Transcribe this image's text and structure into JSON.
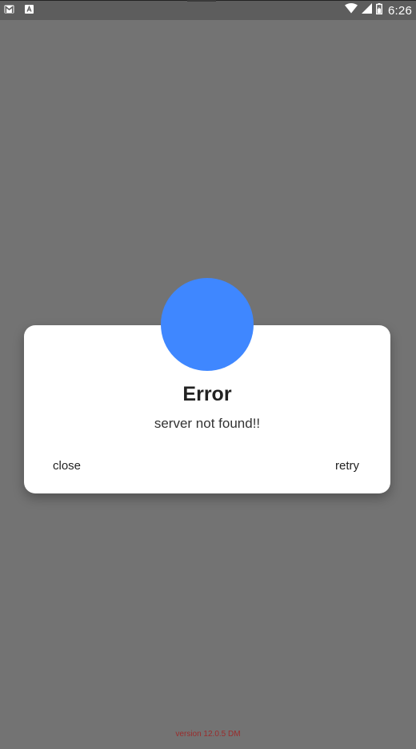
{
  "status_bar": {
    "left_icons": [
      "gmail-icon",
      "app-notification-icon"
    ],
    "right_icons": [
      "wifi-icon",
      "signal-icon",
      "battery-icon"
    ],
    "time": "6:26"
  },
  "dialog": {
    "badge_color": "#3f87ff",
    "title": "Error",
    "message": "server not found!!",
    "close_label": "close",
    "retry_label": "retry"
  },
  "footer": {
    "version": "version 12.0.5 DM"
  },
  "colors": {
    "background_overlay": "#737373",
    "status_bar": "#5d5d5d",
    "dialog_bg": "#ffffff",
    "version_text": "#9a2c2c"
  }
}
